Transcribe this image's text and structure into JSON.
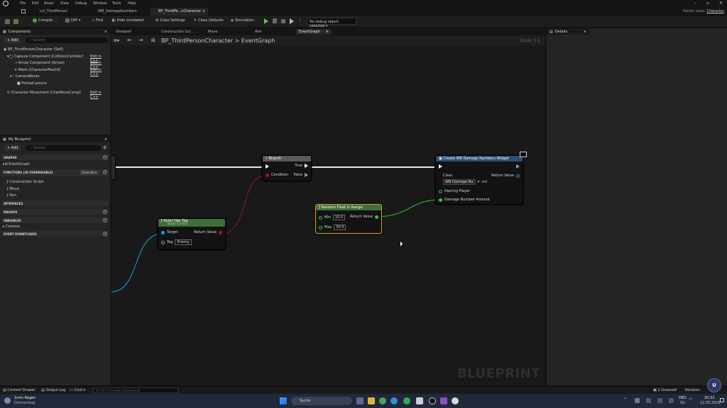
{
  "menu": [
    "File",
    "Edit",
    "Asset",
    "View",
    "Debug",
    "Window",
    "Tools",
    "Help"
  ],
  "doc_tabs": [
    {
      "label": "Lvl_ThirdPerson",
      "active": false
    },
    {
      "label": "WB_DamageNumbers",
      "active": false
    },
    {
      "label": "BP_ThirdPe...nCharacter",
      "active": true
    }
  ],
  "parent_class": {
    "label": "Parent class:",
    "value": "Character"
  },
  "toolbar": {
    "compile": "Compile",
    "diff": "Diff",
    "find": "Find",
    "hide_unrelated": "Hide Unrelated",
    "class_settings": "Class Settings",
    "class_defaults": "Class Defaults",
    "simulation": "Simulation",
    "debug_select": "No debug object selected"
  },
  "components": {
    "title": "Components",
    "add": "+ Add",
    "search_placeholder": "Search",
    "root": "BP_ThirdPersonCharacter (Self)",
    "items": [
      {
        "label": "Capsule Component (CollisionCylinder)",
        "edit": "Edit in C++"
      },
      {
        "label": "Arrow Component (Arrow)",
        "edit": "Edit in C++"
      },
      {
        "label": "Mesh (CharacterMesh0)",
        "edit": "Edit in C++"
      },
      {
        "label": "CameraBoom",
        "edit": ""
      },
      {
        "label": "FollowCamera",
        "edit": ""
      },
      {
        "label": "Character Movement (CharMoveComp)",
        "edit": "Edit in C++"
      }
    ]
  },
  "my_blueprint": {
    "title": "My Blueprint",
    "add": "+ Add",
    "search_placeholder": "Search",
    "graphs": "GRAPHS",
    "event_graph": "EventGraph",
    "functions": "FUNCTIONS (29 OVERRIDABLE)",
    "override": "Override",
    "function_items": [
      "Construction Script",
      "Move",
      "Aim"
    ],
    "interfaces": "INTERFACES",
    "macros": "MACROS",
    "variables": "VARIABLES",
    "camera": "Camera",
    "event_dispatchers": "EVENT DISPATCHERS"
  },
  "editor_tabs": [
    "Viewport",
    "Construction Scr...",
    "Move",
    "Aim",
    "EventGraph"
  ],
  "breadcrumb": {
    "root": "BP_ThirdPersonCharacter",
    "sep": ">",
    "graph": "EventGraph"
  },
  "zoom": "Zoom 1:1",
  "watermark": "BLUEPRINT",
  "nodes": {
    "branch": {
      "title": "Branch",
      "true": "True",
      "false": "False",
      "condition": "Condition"
    },
    "actor_has_tag": {
      "title": "Actor Has Tag",
      "subtitle": "Target is Actor",
      "target": "Target",
      "return": "Return Value",
      "tag": "Tag",
      "tag_value": "Enemy"
    },
    "random_float": {
      "title": "Random Float in Range",
      "min": "Min",
      "min_value": "10.0",
      "max": "Max",
      "max_value": "50.0",
      "return": "Return Value"
    },
    "create_widget": {
      "title": "Create WB Damage Numbers Widget",
      "class": "Class",
      "class_value": "WB Damage Nu",
      "return": "Return Value",
      "owning_player": "Owning Player",
      "damage": "Damage Number Amount"
    }
  },
  "details": {
    "title": "Details"
  },
  "bottom": {
    "content_drawer": "Content Drawer",
    "output_log": "Output Log",
    "cmd": "Cmd",
    "cmd_placeholder": "Enter Console Command",
    "unsaved": "1 Unsaved",
    "revision": "Revision"
  },
  "taskbar": {
    "weather_temp": "1mm Regen",
    "weather_day": "Donnerstag",
    "search": "Suche",
    "lang": "DEU",
    "lang2": "SG",
    "time": "20:32",
    "date": "12.05.2026"
  },
  "colors": {
    "exec": "#ffffff",
    "bool": "#9b1d1d",
    "float": "#35c735",
    "object": "#1aa4d8",
    "branch_header": "#5a5a5a",
    "pure_header": "#3f6f3a",
    "create_header": "#2b4e75"
  }
}
